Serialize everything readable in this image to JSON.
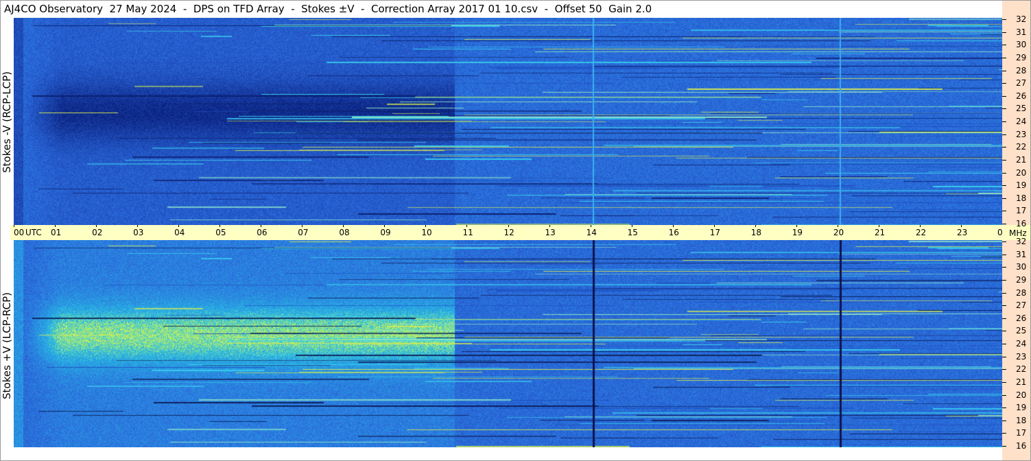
{
  "header": {
    "title": "AJ4CO Observatory  27 May 2024  -  DPS on TFD Array  -  Stokes ±V  -  Correction Array 2017 01 10.csv  -  Offset 50  Gain 2.0"
  },
  "panels": {
    "top_label": "Stokes -V (RCP-LCP)",
    "bottom_label": "Stokes +V (LCP-RCP)"
  },
  "time_axis": {
    "utc_label": "UTC",
    "mhz_label": "MHz",
    "hours": [
      "00",
      "01",
      "02",
      "03",
      "04",
      "05",
      "06",
      "07",
      "08",
      "09",
      "10",
      "11",
      "12",
      "13",
      "14",
      "15",
      "16",
      "17",
      "18",
      "19",
      "20",
      "21",
      "22",
      "23",
      "00"
    ]
  },
  "freq_axis": {
    "labels": [
      "32",
      "31",
      "30",
      "29",
      "28",
      "27",
      "26",
      "25",
      "24",
      "23",
      "22",
      "21",
      "20",
      "19",
      "18",
      "17",
      "16"
    ]
  },
  "chart_data": {
    "type": "heatmap",
    "title": "AJ4CO Observatory  27 May 2024  -  DPS on TFD Array  -  Stokes ±V  -  Correction Array 2017 01 10.csv  -  Offset 50  Gain 2.0",
    "x": {
      "label": "UTC",
      "range": [
        "00",
        "00"
      ],
      "ticks": [
        "00",
        "01",
        "02",
        "03",
        "04",
        "05",
        "06",
        "07",
        "08",
        "09",
        "10",
        "11",
        "12",
        "13",
        "14",
        "15",
        "16",
        "17",
        "18",
        "19",
        "20",
        "21",
        "22",
        "23",
        "00"
      ]
    },
    "y": {
      "label": "MHz",
      "range": [
        16,
        32
      ],
      "ticks": [
        32,
        31,
        30,
        29,
        28,
        27,
        26,
        25,
        24,
        23,
        22,
        21,
        20,
        19,
        18,
        17,
        16
      ]
    },
    "series": [
      {
        "name": "Stokes -V (RCP-LCP)"
      },
      {
        "name": "Stokes +V (LCP-RCP)"
      }
    ],
    "colors": {
      "background": "#2b68dc",
      "low": "#0a2a8c",
      "high": "#36d6f0",
      "peak": "#e8f040",
      "ruler": "#ffffc4",
      "freq_axis": "#ffe0c8"
    },
    "features": {
      "top_dark_region_utc": [
        1,
        10.7
      ],
      "bottom_bright_region_utc": [
        1,
        10.7
      ],
      "vertical_lines_utc": [
        14.05,
        20.05
      ]
    }
  }
}
